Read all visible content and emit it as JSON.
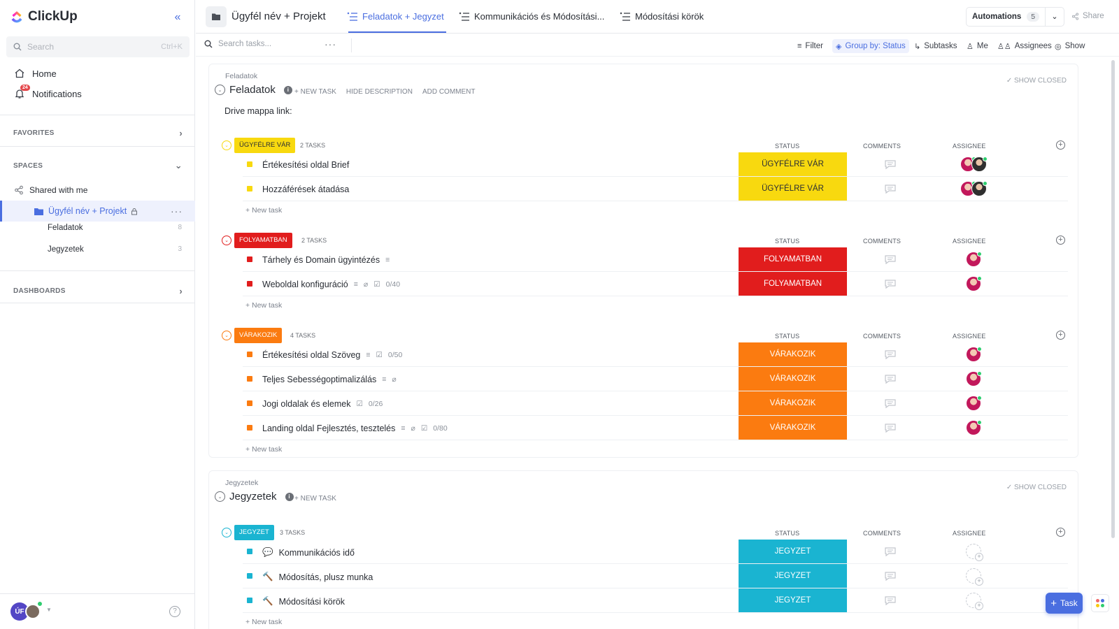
{
  "colors": {
    "accent": "#4a6ee0",
    "ugyfelre_var": "#f8d90f",
    "folyamatban": "#e11d1d",
    "varakozik": "#fb7b10",
    "jegyzet": "#1ab4d1"
  },
  "sidebar": {
    "brand": "ClickUp",
    "search_placeholder": "Search",
    "search_shortcut": "Ctrl+K",
    "home_label": "Home",
    "notifications_label": "Notifications",
    "notifications_count": "24",
    "favorites_label": "FAVORITES",
    "spaces_label": "SPACES",
    "shared_label": "Shared with me",
    "folder_label": "Ügyfél név + Projekt",
    "folder_more": "···",
    "lists": [
      {
        "label": "Feladatok",
        "count": "8"
      },
      {
        "label": "Jegyzetek",
        "count": "3"
      }
    ],
    "dashboards_label": "DASHBOARDS",
    "user_initials": "ÚF",
    "help": "?"
  },
  "header": {
    "project_title": "Ügyfél név + Projekt",
    "tabs": [
      {
        "label": "Feladatok + Jegyzet"
      },
      {
        "label": "Kommunikációs és Módosítási..."
      },
      {
        "label": "Módosítási körök"
      }
    ],
    "automations_label": "Automations",
    "automations_count": "5",
    "share_label": "Share"
  },
  "toolbar": {
    "search_placeholder": "Search tasks...",
    "more": "···",
    "filter": "Filter",
    "group_by": "Group by: Status",
    "subtasks": "Subtasks",
    "me": "Me",
    "assignees": "Assignees",
    "show": "Show"
  },
  "columns": {
    "status": "STATUS",
    "comments": "COMMENTS",
    "assignee": "ASSIGNEE"
  },
  "list1": {
    "crumb": "Feladatok",
    "title": "Feladatok",
    "new_task": "+ NEW TASK",
    "hide_desc": "HIDE DESCRIPTION",
    "add_comment": "ADD COMMENT",
    "show_closed": "✓ SHOW CLOSED",
    "description": "Drive mappa link:",
    "groups": [
      {
        "status": "ÜGYFÉLRE VÁR",
        "count": "2 TASKS",
        "new_task": "+ New task",
        "tasks": [
          {
            "name": "Értékesítési oldal Brief",
            "status": "ÜGYFÉLRE VÁR"
          },
          {
            "name": "Hozzáférések átadása",
            "status": "ÜGYFÉLRE VÁR"
          }
        ]
      },
      {
        "status": "FOLYAMATBAN",
        "count": "2 TASKS",
        "new_task": "+ New task",
        "tasks": [
          {
            "name": "Tárhely és Domain ügyintézés",
            "status": "FOLYAMATBAN"
          },
          {
            "name": "Weboldal konfiguráció",
            "status": "FOLYAMATBAN",
            "checklist": "0/40"
          }
        ]
      },
      {
        "status": "VÁRAKOZIK",
        "count": "4 TASKS",
        "new_task": "+ New task",
        "tasks": [
          {
            "name": "Értékesítési oldal Szöveg",
            "status": "VÁRAKOZIK",
            "checklist": "0/50"
          },
          {
            "name": "Teljes Sebességoptimalizálás",
            "status": "VÁRAKOZIK"
          },
          {
            "name": "Jogi oldalak és elemek",
            "status": "VÁRAKOZIK",
            "checklist": "0/26"
          },
          {
            "name": "Landing oldal Fejlesztés, tesztelés",
            "status": "VÁRAKOZIK",
            "checklist": "0/80"
          }
        ]
      }
    ]
  },
  "list2": {
    "crumb": "Jegyzetek",
    "title": "Jegyzetek",
    "new_task": "+ NEW TASK",
    "show_closed": "✓ SHOW CLOSED",
    "group": {
      "status": "JEGYZET",
      "count": "3 TASKS",
      "new_task": "+ New task",
      "tasks": [
        {
          "name": "Kommunikációs idő",
          "status": "JEGYZET",
          "emoji": "💬"
        },
        {
          "name": "Módosítás, plusz munka",
          "status": "JEGYZET",
          "emoji": "🔨"
        },
        {
          "name": "Módosítási körök",
          "status": "JEGYZET",
          "emoji": "🔨"
        }
      ]
    }
  },
  "fab": {
    "task_label": "Task"
  }
}
